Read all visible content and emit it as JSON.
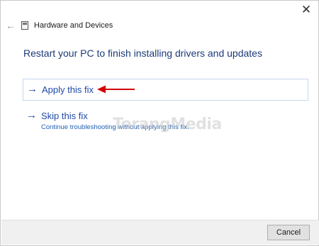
{
  "window": {
    "title": "Hardware and Devices",
    "close_icon": "close-icon",
    "back_icon": "back-arrow-icon",
    "app_icon": "hardware-devices-icon"
  },
  "main": {
    "heading": "Restart your PC to finish installing drivers and updates",
    "options": [
      {
        "title": "Apply this fix",
        "icon": "arrow-right-icon"
      },
      {
        "title": "Skip this fix",
        "description": "Continue troubleshooting without applying this fix.",
        "icon": "arrow-right-icon"
      }
    ],
    "annotation_arrow_color": "#d40000",
    "watermark": "TorangMedia"
  },
  "footer": {
    "cancel_label": "Cancel"
  },
  "colors": {
    "link_blue": "#1f4aa8",
    "heading_blue": "#1b3a78",
    "footer_bg": "#f0f0f0"
  }
}
